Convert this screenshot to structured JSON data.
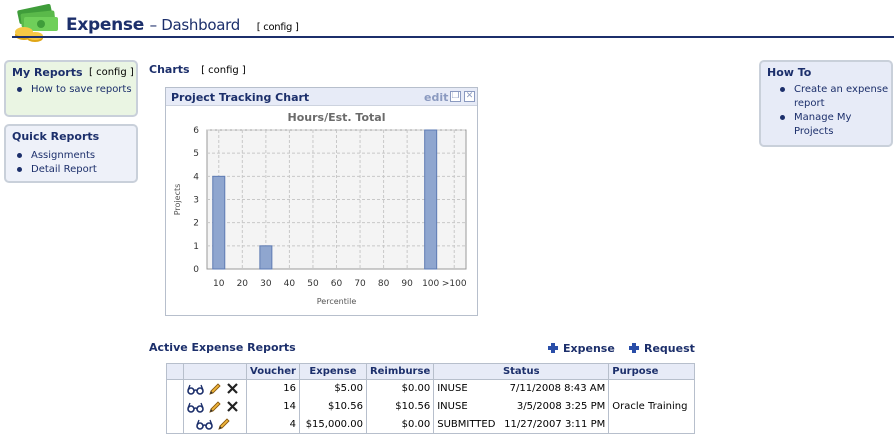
{
  "header": {
    "app_name": "Expense",
    "subtitle": "– Dashboard",
    "config": "[ config ]"
  },
  "my_reports": {
    "title": "My Reports",
    "config": "[ config ]",
    "items": [
      "How to save reports"
    ]
  },
  "quick_reports": {
    "title": "Quick Reports",
    "items": [
      "Assignments",
      "Detail Report"
    ]
  },
  "how_to": {
    "title": "How To",
    "items": [
      "Create an expense report",
      "Manage My Projects"
    ]
  },
  "charts_section": {
    "title": "Charts",
    "config": "[ config ]"
  },
  "chart_panel": {
    "title": "Project Tracking Chart",
    "edit": "edit"
  },
  "chart_data": {
    "type": "bar",
    "title": "Hours/Est. Total",
    "xlabel": "Percentile",
    "ylabel": "Projects",
    "categories": [
      "10",
      "20",
      "30",
      "40",
      "50",
      "60",
      "70",
      "80",
      "90",
      "100",
      ">100"
    ],
    "values": [
      4,
      0,
      1,
      0,
      0,
      0,
      0,
      0,
      0,
      6,
      0
    ],
    "ylim": [
      0,
      6
    ],
    "yticks": [
      "0",
      "1",
      "2",
      "3",
      "4",
      "5",
      "6"
    ],
    "grid": true,
    "colors": {
      "bar": "#8fa6cf",
      "bar_edge": "#5e7bb3"
    }
  },
  "active_reports": {
    "title": "Active Expense Reports",
    "add_expense": "Expense",
    "add_request": "Request",
    "columns": [
      "Voucher",
      "Expense",
      "Reimburse",
      "Status",
      "Purpose"
    ],
    "rows": [
      {
        "voucher": "16",
        "expense": "$5.00",
        "reimburse": "$0.00",
        "status": "INUSE",
        "date": "7/11/2008 8:43 AM",
        "purpose": "",
        "actions": [
          "view",
          "edit",
          "delete"
        ]
      },
      {
        "voucher": "14",
        "expense": "$10.56",
        "reimburse": "$10.56",
        "status": "INUSE",
        "date": "3/5/2008 3:25 PM",
        "purpose": "Oracle Training",
        "actions": [
          "view",
          "edit",
          "delete"
        ]
      },
      {
        "voucher": "4",
        "expense": "$15,000.00",
        "reimburse": "$0.00",
        "status": "SUBMITTED",
        "date": "11/27/2007 3:11 PM",
        "purpose": "",
        "actions": [
          "view",
          "edit"
        ]
      }
    ]
  },
  "colors": {
    "brand": "#1c2f6b",
    "panel": "#e7ebf7",
    "accent": "#2a4ea8"
  }
}
